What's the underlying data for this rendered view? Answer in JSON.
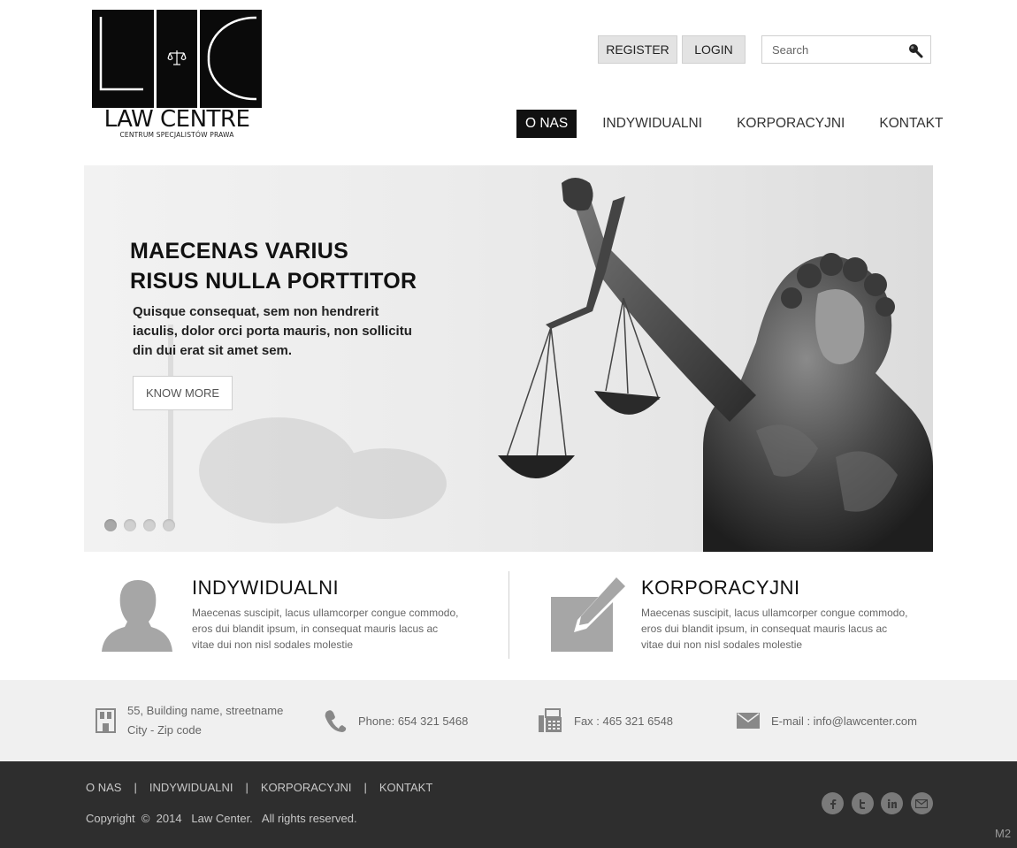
{
  "header": {
    "logo_text": "LAW CENTRE",
    "logo_subtitle": "CENTRUM SPECJALISTÓW PRAWA",
    "register_label": "REGISTER",
    "login_label": "LOGIN",
    "search_placeholder": "Search"
  },
  "nav": {
    "items": [
      {
        "label": "O NAS",
        "active": true
      },
      {
        "label": "INDYWIDUALNI",
        "active": false
      },
      {
        "label": "KORPORACYJNI",
        "active": false
      },
      {
        "label": "KONTAKT",
        "active": false
      }
    ]
  },
  "hero": {
    "title_line1": "MAECENAS VARIUS",
    "title_line2": "RISUS NULLA PORTTITOR",
    "text_line1": "Quisque consequat, sem non hendrerit",
    "text_line2": "iaculis, dolor orci porta mauris, non sollicitu",
    "text_line3": "din dui erat sit amet sem.",
    "button_label": "KNOW MORE",
    "slides_count": 4,
    "active_slide": 1
  },
  "services": [
    {
      "title": "INDYWIDUALNI",
      "icon": "person-icon",
      "desc_line1": "Maecenas suscipit, lacus ullamcorper congue commodo,",
      "desc_line2": "eros dui blandit ipsum, in consequat mauris lacus ac",
      "desc_line3": "vitae dui non nisl sodales molestie"
    },
    {
      "title": "KORPORACYJNI",
      "icon": "edit-icon",
      "desc_line1": "Maecenas suscipit, lacus ullamcorper congue commodo,",
      "desc_line2": "eros dui blandit ipsum, in consequat mauris lacus ac",
      "desc_line3": "vitae dui non nisl sodales molestie"
    }
  ],
  "contact": {
    "address_line1": "55, Building name, streetname",
    "address_line2": "City - Zip code",
    "phone": "Phone: 654 321 5468",
    "fax": "Fax : 465 321 6548",
    "email": "E-mail : info@lawcenter.com"
  },
  "footer": {
    "nav": [
      "O NAS",
      "INDYWIDUALNI",
      "KORPORACYJNI",
      "KONTAKT"
    ],
    "separator": "|",
    "copyright": "Copyright  ©  2014   Law Center.   All rights reserved.",
    "socials": [
      "facebook-icon",
      "twitter-icon",
      "linkedin-icon",
      "mail-icon"
    ],
    "badge": "M2"
  },
  "colors": {
    "nav_active_bg": "#111111",
    "footer_bg": "#2e2e2e",
    "contact_bar_bg": "#f0f0f0",
    "icon_gray": "#a6a6a6"
  }
}
